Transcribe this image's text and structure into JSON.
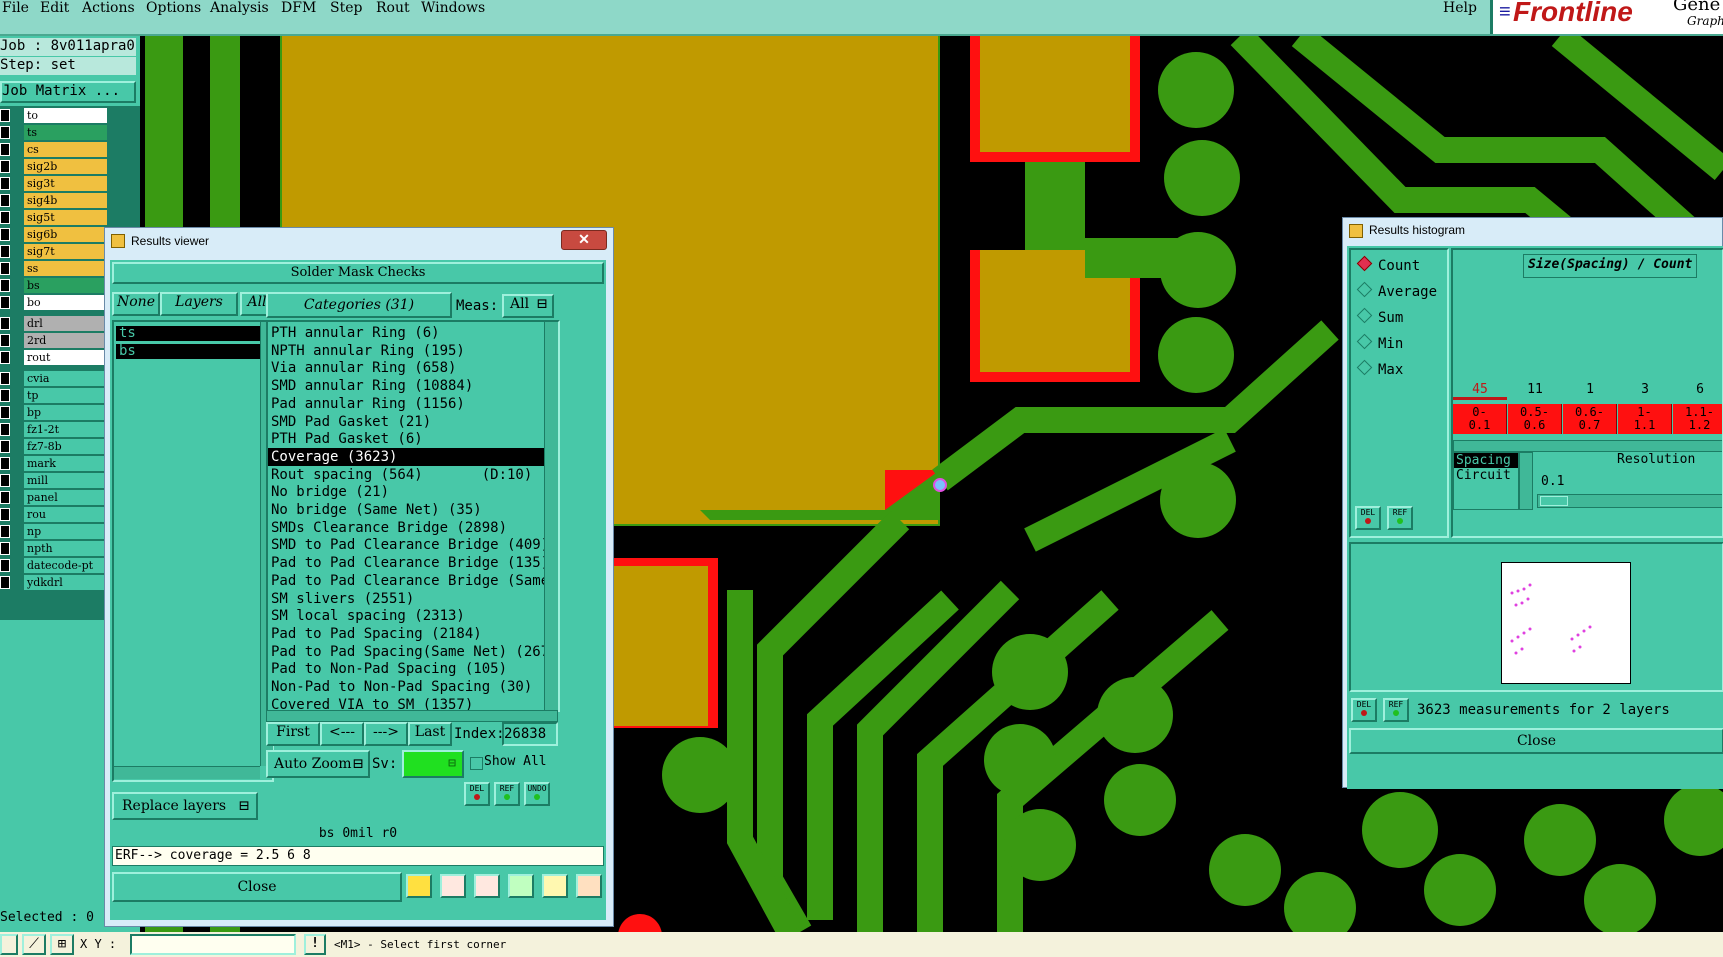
{
  "menubar": {
    "items": [
      "File",
      "Edit",
      "Actions",
      "Options",
      "Analysis",
      "DFM",
      "Step",
      "Rout",
      "Windows"
    ],
    "help": "Help",
    "brand": "Frontline",
    "brand_sub1": "Gene",
    "brand_sub2": "Graph"
  },
  "job_panel": {
    "job": "Job : 8v011apra0",
    "step": "Step: set",
    "job_matrix": "Job Matrix ...",
    "layers": [
      {
        "name": "to",
        "color": "#ffffff"
      },
      {
        "name": "ts",
        "color": "#2aa060"
      },
      {
        "name": "cs",
        "color": "#f0c040"
      },
      {
        "name": "sig2b",
        "color": "#f0c040"
      },
      {
        "name": "sig3t",
        "color": "#f0c040"
      },
      {
        "name": "sig4b",
        "color": "#f0c040"
      },
      {
        "name": "sig5t",
        "color": "#f0c040"
      },
      {
        "name": "sig6b",
        "color": "#f0c040"
      },
      {
        "name": "sig7t",
        "color": "#f0c040"
      },
      {
        "name": "ss",
        "color": "#f0c040"
      },
      {
        "name": "bs",
        "color": "#2aa060"
      },
      {
        "name": "bo",
        "color": "#ffffff"
      },
      {
        "name": "drl",
        "color": "#b0b0b0"
      },
      {
        "name": "2rd",
        "color": "#b0b0b0"
      },
      {
        "name": "rout",
        "color": "#ffffff"
      },
      {
        "name": "cvia",
        "color": "#48c8a8"
      },
      {
        "name": "tp",
        "color": "#48c8a8"
      },
      {
        "name": "bp",
        "color": "#48c8a8"
      },
      {
        "name": "fz1-2t",
        "color": "#48c8a8"
      },
      {
        "name": "fz7-8b",
        "color": "#48c8a8"
      },
      {
        "name": "mark",
        "color": "#48c8a8"
      },
      {
        "name": "mill",
        "color": "#48c8a8"
      },
      {
        "name": "panel",
        "color": "#48c8a8"
      },
      {
        "name": "rou",
        "color": "#48c8a8"
      },
      {
        "name": "np",
        "color": "#48c8a8"
      },
      {
        "name": "npth",
        "color": "#48c8a8"
      },
      {
        "name": "datecode-pt",
        "color": "#48c8a8"
      },
      {
        "name": "ydkdrl",
        "color": "#48c8a8"
      }
    ],
    "selected": "Selected : 0"
  },
  "results_viewer": {
    "title": "Results viewer",
    "heading": "Solder Mask Checks",
    "none_label": "None",
    "layers_label": "Layers",
    "all_label": "All",
    "categories_label": "Categories (31)",
    "meas_label": "Meas:",
    "meas_value": "All",
    "layer_list": [
      "ts",
      "bs"
    ],
    "categories": [
      "PTH annular Ring (6)",
      "NPTH annular Ring (195)",
      "Via annular Ring (658)",
      "SMD annular Ring (10884)",
      "Pad annular Ring (1156)",
      "SMD Pad Gasket (21)",
      "PTH Pad Gasket (6)",
      "Coverage (3623)",
      "Rout spacing (564)       (D:10)",
      "No bridge (21)",
      "No bridge (Same Net) (35)",
      "SMDs Clearance Bridge (2898)",
      "SMD to Pad Clearance Bridge (409)",
      "Pad to Pad Clearance Bridge (135)",
      "Pad to Pad Clearance Bridge (Same",
      "SM slivers (2551)",
      "SM local spacing (2313)",
      "Pad to Pad Spacing (2184)",
      "Pad to Pad Spacing(Same Net) (267",
      "Pad to Non-Pad Spacing (105)",
      "Non-Pad to Non-Pad Spacing (30)",
      "Covered VIA to SM (1357)"
    ],
    "selected_category": "Coverage (3623)",
    "first": "First",
    "prev": "<---",
    "next": "--->",
    "last": "Last",
    "index_label": "Index:",
    "index_value": "26838",
    "auto_zoom": "Auto Zoom",
    "sv_label": "Sv:",
    "show_all": "Show All",
    "replace_layers": "Replace layers",
    "del": "DEL",
    "ref": "REF",
    "undo": "UNDO",
    "status_line": "bs 0mil  r0",
    "erf_line": "ERF--> coverage = 2.5 6 8",
    "close": "Close"
  },
  "histogram": {
    "title": "Results histogram",
    "modes": [
      "Count",
      "Average",
      "Sum",
      "Min",
      "Max"
    ],
    "selected_mode": "Count",
    "chart_title": "Size(Spacing) / Count",
    "counts": [
      "45",
      "11",
      "1",
      "3",
      "6"
    ],
    "bins": [
      "0-\n0.1",
      "0.5-\n0.6",
      "0.6-\n0.7",
      "1-\n1.1",
      "1.1-\n1.2"
    ],
    "meas_options": [
      "Spacing",
      "Circuit"
    ],
    "resolution_label": "Resolution",
    "resolution_value": "0.1",
    "del": "DEL",
    "ref": "REF",
    "summary": "3623 measurements for 2 layers",
    "close": "Close"
  },
  "statusbar": {
    "xy_label": "X Y :",
    "xy_value": "",
    "message": "<M1> - Select first corner"
  },
  "colors": {
    "panel": "#48c8a8",
    "board_green": "#3a9a12",
    "copper": "#c09a00",
    "error_red": "#ff1010"
  }
}
